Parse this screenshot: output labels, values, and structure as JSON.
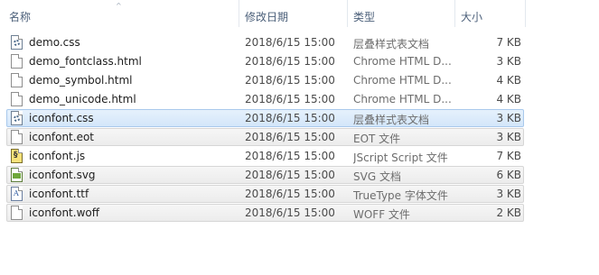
{
  "columns": {
    "name": "名称",
    "date": "修改日期",
    "type": "类型",
    "size": "大小",
    "sort_indicator": "^"
  },
  "files": [
    {
      "name": "demo.css",
      "date": "2018/6/15 15:00",
      "type": "层叠样式表文档",
      "size": "7 KB",
      "icon": "css-file-icon",
      "state": "normal"
    },
    {
      "name": "demo_fontclass.html",
      "date": "2018/6/15 15:00",
      "type": "Chrome HTML D...",
      "size": "3 KB",
      "icon": "html-file-icon",
      "state": "normal"
    },
    {
      "name": "demo_symbol.html",
      "date": "2018/6/15 15:00",
      "type": "Chrome HTML D...",
      "size": "4 KB",
      "icon": "html-file-icon",
      "state": "normal"
    },
    {
      "name": "demo_unicode.html",
      "date": "2018/6/15 15:00",
      "type": "Chrome HTML D...",
      "size": "4 KB",
      "icon": "html-file-icon",
      "state": "normal"
    },
    {
      "name": "iconfont.css",
      "date": "2018/6/15 15:00",
      "type": "层叠样式表文档",
      "size": "3 KB",
      "icon": "css-file-icon",
      "state": "selected"
    },
    {
      "name": "iconfont.eot",
      "date": "2018/6/15 15:00",
      "type": "EOT 文件",
      "size": "3 KB",
      "icon": "file-icon",
      "state": "grey"
    },
    {
      "name": "iconfont.js",
      "date": "2018/6/15 15:00",
      "type": "JScript Script 文件",
      "size": "7 KB",
      "icon": "js-file-icon",
      "state": "normal"
    },
    {
      "name": "iconfont.svg",
      "date": "2018/6/15 15:00",
      "type": "SVG 文档",
      "size": "6 KB",
      "icon": "svg-file-icon",
      "state": "grey"
    },
    {
      "name": "iconfont.ttf",
      "date": "2018/6/15 15:00",
      "type": "TrueType 字体文件",
      "size": "3 KB",
      "icon": "font-file-icon",
      "state": "grey"
    },
    {
      "name": "iconfont.woff",
      "date": "2018/6/15 15:00",
      "type": "WOFF 文件",
      "size": "2 KB",
      "icon": "file-icon",
      "state": "grey"
    }
  ],
  "colors": {
    "header_text": "#4c607a",
    "selected_bg": "#d9eafb",
    "selected_border": "#a9c9ec",
    "grey_bg": "#f0f0f0"
  }
}
